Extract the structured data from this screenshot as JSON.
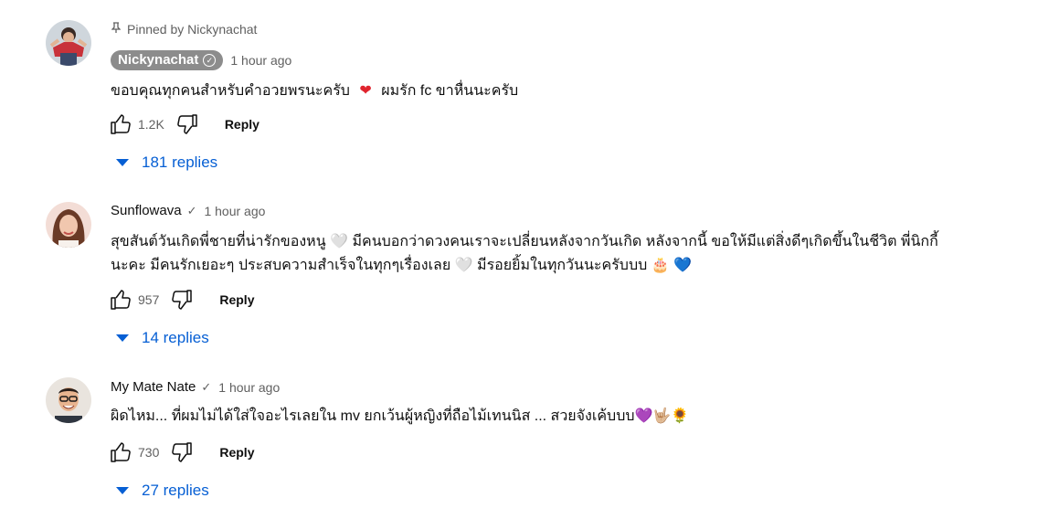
{
  "comments": [
    {
      "pinned_label": "Pinned by Nickynachat",
      "author": "Nickynachat",
      "time": "1 hour ago",
      "text_parts": [
        "ขอบคุณทุกคนสำหรับคำอวยพรนะครับ",
        "❤",
        "ผมรัก fc ขาหื่นนะครับ"
      ],
      "likes": "1.2K",
      "reply_label": "Reply",
      "replies_label": "181 replies"
    },
    {
      "author": "Sunflowava",
      "time": "1 hour ago",
      "text_line1": "สุขสันต์วันเกิดพี่ชายที่น่ารักของหนู 🤍 มีคนบอกว่าดวงคนเราจะเปลี่ยนหลังจากวันเกิด หลังจากนี้ ขอให้มีแต่สิ่งดีๆเกิดขึ้นในชีวิต พี่นิกกี้",
      "text_line2": "นะคะ มีคนรักเยอะๆ ประสบความสำเร็จในทุกๆเรื่องเลย 🤍 มีรอยยิ้มในทุกวันนะครับบบ 🎂 💙",
      "likes": "957",
      "reply_label": "Reply",
      "replies_label": "14 replies"
    },
    {
      "author": "My Mate Nate",
      "time": "1 hour ago",
      "text": "ผิดไหม... ที่ผมไม่ได้ใส่ใจอะไรเลยใน mv ยกเว้นผู้หญิงที่ถือไม้เทนนิส ... สวยจังเค้บบบ💜🤟🏼🌻",
      "likes": "730",
      "reply_label": "Reply",
      "replies_label": "27 replies"
    }
  ],
  "icons": {
    "pin": "pin-icon",
    "verified": "verified-icon",
    "check": "check-icon",
    "like": "thumbs-up-icon",
    "dislike": "thumbs-down-icon",
    "caret": "caret-down-icon"
  },
  "colors": {
    "link_blue": "#065fd4",
    "chip_bg": "#8c8c8c",
    "secondary_text": "#606060"
  }
}
